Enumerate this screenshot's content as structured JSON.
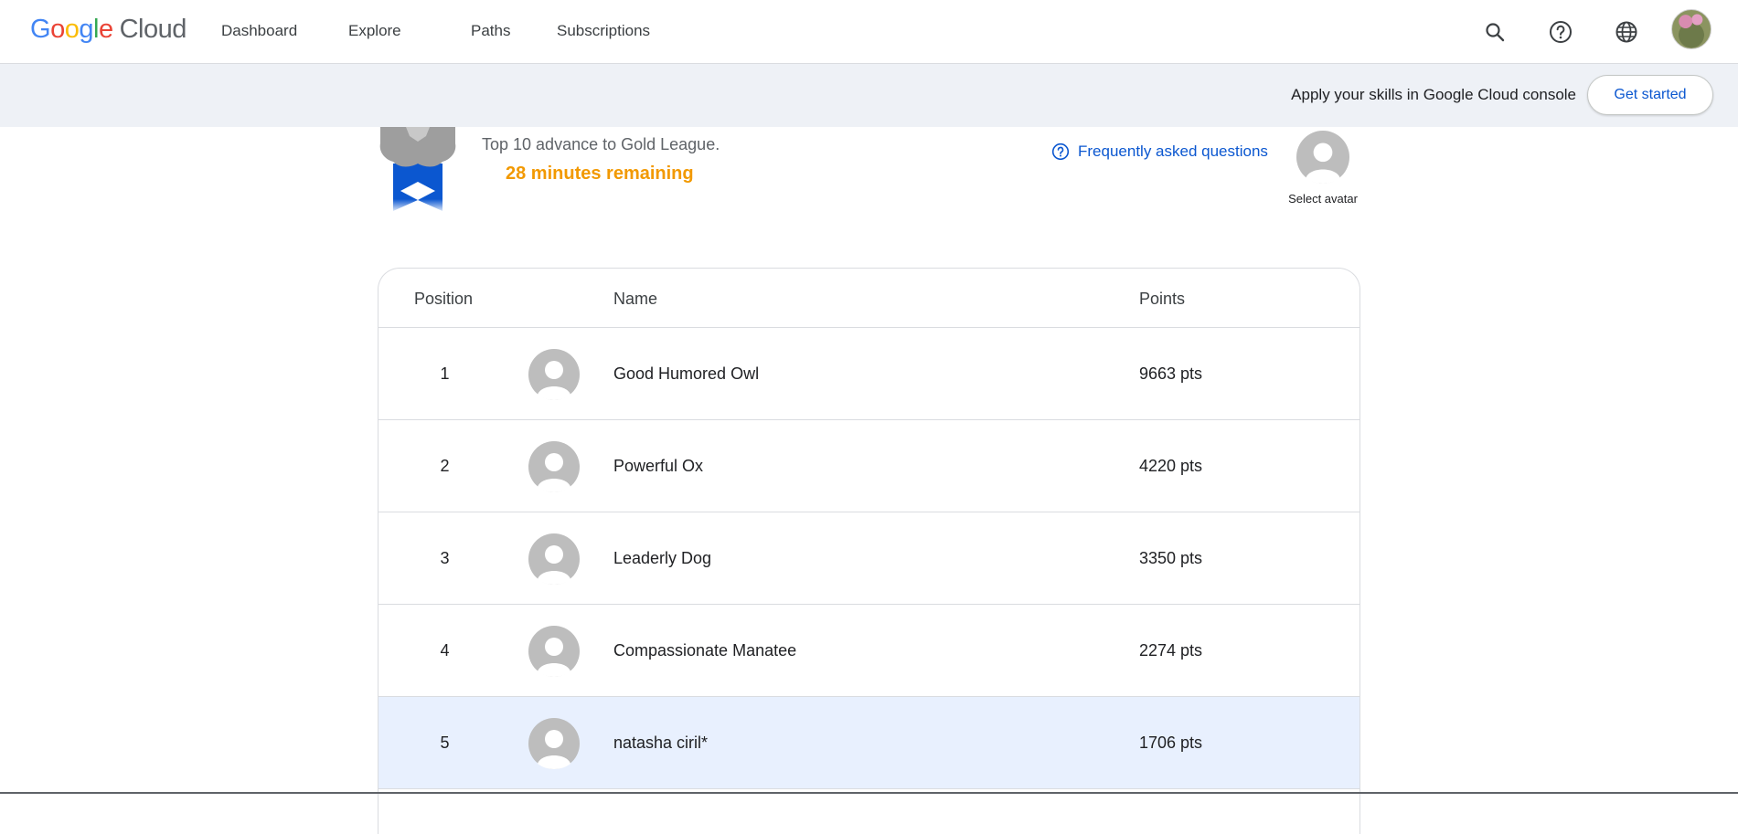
{
  "header": {
    "logo": {
      "g": "G",
      "o1": "o",
      "o2": "o",
      "g2": "g",
      "l": "l",
      "e": "e",
      "cloud": "Cloud"
    },
    "nav": [
      "Dashboard",
      "Explore",
      "Paths",
      "Subscriptions"
    ],
    "icons": [
      "search-icon",
      "help-icon",
      "globe-icon",
      "user-avatar"
    ]
  },
  "banner": {
    "text": "Apply your skills in Google Cloud console",
    "button": "Get started"
  },
  "league": {
    "advance_text": "Top 10 advance to Gold League.",
    "remaining": "28 minutes remaining",
    "faq": "Frequently asked questions",
    "select_avatar": "Select avatar"
  },
  "table": {
    "headers": {
      "position": "Position",
      "name": "Name",
      "points": "Points"
    },
    "rows": [
      {
        "position": "1",
        "name": "Good Humored Owl",
        "points": "9663 pts"
      },
      {
        "position": "2",
        "name": "Powerful Ox",
        "points": "4220 pts"
      },
      {
        "position": "3",
        "name": "Leaderly Dog",
        "points": "3350 pts"
      },
      {
        "position": "4",
        "name": "Compassionate Manatee",
        "points": "2274 pts"
      },
      {
        "position": "5",
        "name": "natasha ciril*",
        "points": "1706 pts"
      }
    ]
  },
  "colors": {
    "accent_blue": "#0b57d0",
    "remaining_orange": "#f29900",
    "highlight_row": "#e8f0fe",
    "banner_bg": "#eef1f6"
  }
}
